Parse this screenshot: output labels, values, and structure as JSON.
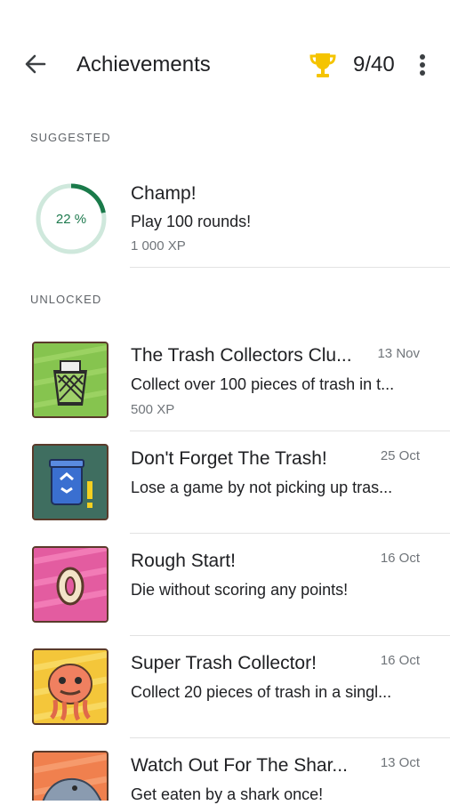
{
  "appbar": {
    "title": "Achievements",
    "count": "9/40",
    "icons": {
      "back": "arrow-left-icon",
      "trophy": "trophy-icon",
      "more": "more-vert-icon"
    },
    "trophy_color": "#f5c400"
  },
  "suggested": {
    "header": "SUGGESTED",
    "item": {
      "title": "Champ!",
      "description": "Play 100 rounds!",
      "xp": "1 000 XP",
      "progress_label": "22 %",
      "progress": 0.22
    }
  },
  "unlocked": {
    "header": "UNLOCKED",
    "items": [
      {
        "title": "The Trash Collectors Clu...",
        "description": "Collect over 100 pieces of trash in t...",
        "xp": "500 XP",
        "date": "13 Nov"
      },
      {
        "title": "Don't Forget The Trash!",
        "description": "Lose a game by not picking up tras...",
        "date": "25 Oct"
      },
      {
        "title": "Rough Start!",
        "description": "Die without scoring any points!",
        "date": "16 Oct"
      },
      {
        "title": "Super Trash Collector!",
        "description": "Collect 20 pieces of trash in a singl...",
        "date": "16 Oct"
      },
      {
        "title": "Watch Out For The Shar...",
        "description": "Get eaten by a shark once!",
        "date": "13 Oct"
      }
    ]
  },
  "colors": {
    "progress": "#1a7a4a",
    "progress_track": "#cfe8dc",
    "divider": "#e2e2e2"
  }
}
